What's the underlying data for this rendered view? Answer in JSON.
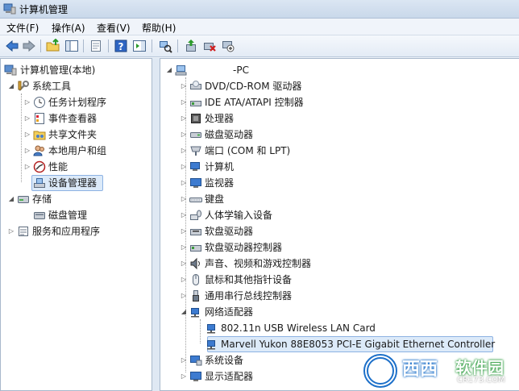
{
  "window": {
    "title": "计算机管理"
  },
  "menu": [
    {
      "label": "文件(F)"
    },
    {
      "label": "操作(A)"
    },
    {
      "label": "查看(V)"
    },
    {
      "label": "帮助(H)"
    }
  ],
  "toolbar": {
    "icons": [
      "back-icon",
      "forward-icon",
      "up-folder-icon",
      "console-tree-icon",
      "properties-icon",
      "help-icon",
      "action-pane-icon",
      "scan-hardware-icon",
      "update-driver-icon",
      "uninstall-device-icon",
      "disable-device-icon"
    ]
  },
  "left_tree": {
    "root": {
      "label": "计算机管理(本地)"
    },
    "system_tools": {
      "label": "系统工具"
    },
    "system_children": [
      {
        "label": "任务计划程序"
      },
      {
        "label": "事件查看器"
      },
      {
        "label": "共享文件夹"
      },
      {
        "label": "本地用户和组"
      },
      {
        "label": "性能"
      },
      {
        "label": "设备管理器"
      }
    ],
    "storage": {
      "label": "存储"
    },
    "disk_management": {
      "label": "磁盘管理"
    },
    "services": {
      "label": "服务和应用程序"
    }
  },
  "device_tree": {
    "computer_name": "-PC",
    "categories": [
      {
        "label": "DVD/CD-ROM 驱动器"
      },
      {
        "label": "IDE ATA/ATAPI 控制器"
      },
      {
        "label": "处理器"
      },
      {
        "label": "磁盘驱动器"
      },
      {
        "label": "端口 (COM 和 LPT)"
      },
      {
        "label": "计算机"
      },
      {
        "label": "监视器"
      },
      {
        "label": "键盘"
      },
      {
        "label": "人体学输入设备"
      },
      {
        "label": "软盘驱动器"
      },
      {
        "label": "软盘驱动器控制器"
      },
      {
        "label": "声音、视频和游戏控制器"
      },
      {
        "label": "鼠标和其他指针设备"
      },
      {
        "label": "通用串行总线控制器"
      },
      {
        "label": "网络适配器"
      }
    ],
    "network_children": [
      {
        "label": "802.11n USB Wireless LAN Card"
      },
      {
        "label": "Marvell Yukon 88E8053 PCI-E Gigabit Ethernet Controller"
      }
    ],
    "after": [
      {
        "label": "系统设备"
      },
      {
        "label": "显示适配器"
      }
    ]
  },
  "watermark": {
    "text1": "西西",
    "text2": "软件园",
    "text3": "CR173.COM"
  }
}
